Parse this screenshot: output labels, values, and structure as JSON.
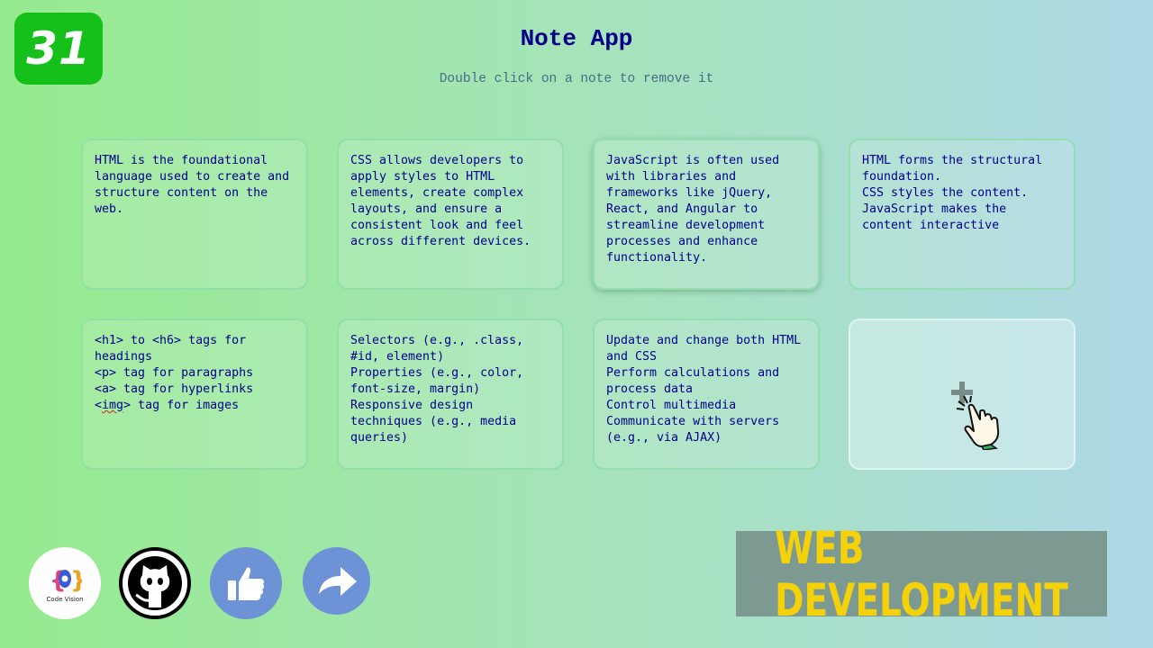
{
  "badge": {
    "number": "31"
  },
  "app": {
    "title": "Note App",
    "subtitle": "Double click on a note to remove it"
  },
  "notes": [
    {
      "text": "HTML is the foundational language used to create and structure content on the web."
    },
    {
      "text": "CSS allows developers to apply styles to HTML elements, create complex layouts, and ensure a consistent look and feel across different devices."
    },
    {
      "text": "JavaScript is often used with libraries and frameworks like jQuery, React, and Angular to streamline development processes and enhance functionality."
    },
    {
      "text": "HTML forms the structural foundation.\nCSS styles the content.\nJavaScript makes the content interactive"
    },
    {
      "text_before": "<h1> to <h6> tags for headings\n<p> tag for paragraphs\n<a> tag for hyperlinks\n<",
      "text_misspelled": "img",
      "text_after": "> tag for images"
    },
    {
      "text": "Selectors (e.g., .class, #id, element)\nProperties (e.g., color, font-size, margin)\nResponsive design techniques (e.g., media queries)"
    },
    {
      "text": "Update and change both HTML and CSS\nPerform calculations and process data\nControl multimedia\nCommunicate with servers (e.g., via AJAX)"
    }
  ],
  "add_note": {
    "icon": "plus-icon"
  },
  "social": {
    "code_vision_label": "Code Vision"
  },
  "banner": {
    "text": "WEB DEVELOPMENT"
  },
  "colors": {
    "title": "#00008b",
    "badge": "#16c01a",
    "banner_text": "#f5d10a",
    "banner_bg": "#7c9a92",
    "social_blue": "#6d93d6"
  }
}
